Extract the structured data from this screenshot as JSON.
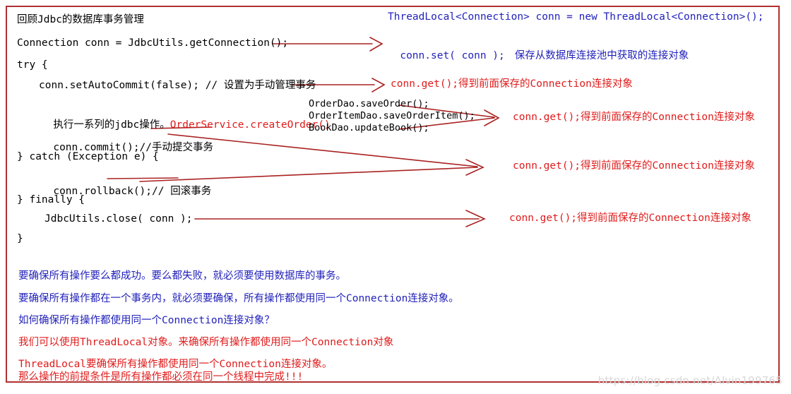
{
  "document": {
    "title_line": "回顾Jdbc的数据库事务管理",
    "watermark": "https://blog.csdn.net/Alvin199765"
  },
  "code": {
    "line_connection": "Connection conn = JdbcUtils.getConnection();",
    "line_try": "try {",
    "line_setautocommit": "conn.setAutoCommit(false); // 设置为手动管理事务",
    "line_jdbc_ops_black": "执行一系列的jdbc操作。",
    "line_jdbc_ops_red": "OrderService.createOrder()",
    "line_commit_black": "conn.commit();//",
    "line_commit_strike": "手动提交事务",
    "line_catch": "} catch (Exception e) {",
    "line_rollback_black": "conn.rollback();",
    "line_rollback_strike": "// 回滚事务",
    "line_finally": "} finally {",
    "line_close": "JdbcUtils.close( conn );",
    "line_closing_brace": "}"
  },
  "dao_block": {
    "line1": "OrderDao.saveOrder();",
    "line2": "OrderItemDao.saveOrderItem();",
    "line3": "BookDao.updateBook();"
  },
  "annotations": {
    "threadlocal_decl": "ThreadLocal<Connection> conn = new ThreadLocal<Connection>();",
    "conn_set_code": "conn.set( conn );",
    "conn_set_desc": "保存从数据库连接池中获取的连接对象",
    "conn_get_1": "conn.get();得到前面保存的Connection连接对象",
    "conn_get_2": "conn.get();得到前面保存的Connection连接对象",
    "conn_get_3": "conn.get();得到前面保存的Connection连接对象",
    "conn_get_4": "conn.get();得到前面保存的Connection连接对象"
  },
  "summary": {
    "line1": "要确保所有操作要么都成功。要么都失败，就必须要使用数据库的事务。",
    "line2": "要确保所有操作都在一个事务内，就必须要确保，所有操作都使用同一个Connection连接对象。",
    "line3": "如何确保所有操作都使用同一个Connection连接对象？",
    "line4": "我们可以使用ThreadLocal对象。来确保所有操作都使用同一个Connection对象",
    "line5": "ThreadLocal要确保所有操作都使用同一个Connection连接对象。",
    "line6": "那么操作的前提条件是所有操作都必须在同一个线程中完成!!!"
  },
  "colors": {
    "border": "#b03030",
    "blue_text": "#2222bb",
    "red_text": "#e01b1b",
    "arrow": "#aa2222",
    "black_text": "#000000",
    "watermark": "#d8d8d8"
  }
}
